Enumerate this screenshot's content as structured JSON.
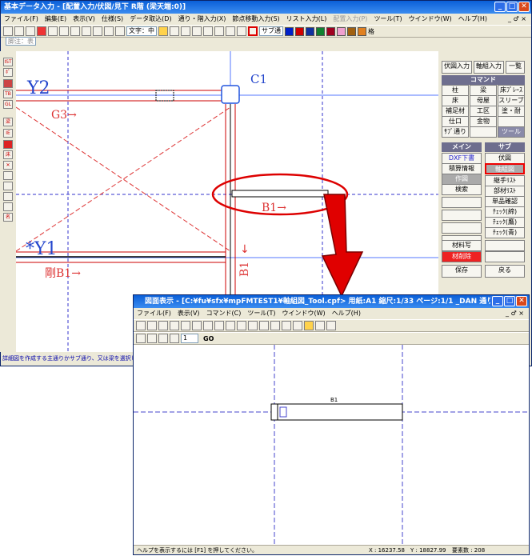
{
  "main": {
    "title": "基本データ入力 - [配置入力/伏図/見下 R階 (梁天端:0)]",
    "menu": [
      "ファイル(F)",
      "編集(E)",
      "表示(V)",
      "仕様(S)",
      "データ取込(D)",
      "通り・階入力(X)",
      "節点移動入力(S)",
      "リスト入力(L)",
      "配置入力(P)",
      "ツール(T)",
      "ウインドウ(W)",
      "ヘルプ(H)"
    ],
    "text_select": "文字：中",
    "sub_grid": "サブ通",
    "lattice": "格",
    "fold": "脚注：表",
    "status": "詳細図を作成する主通りかサブ通り、又は梁を選択してください"
  },
  "drawing": {
    "y2": "Y2",
    "y1": "*Y1",
    "c1": "C1",
    "g3": "G3→",
    "b1": "B1→",
    "b1v": "B1",
    "gb1": "剛B1→"
  },
  "left_tools": [
    "IST",
    "ﾎﾟ",
    "",
    "TB",
    "GL",
    "",
    "梁",
    "IE",
    "",
    "床",
    "",
    "",
    "",
    "",
    "",
    "",
    "名"
  ],
  "panel": {
    "tabs": [
      "伏図入力",
      "軸組入力",
      "一覧"
    ],
    "cmd_header": "コマンド",
    "cmd": [
      "柱",
      "梁",
      "床ﾌﾞﾚｰｽ",
      "床",
      "母屋",
      "スリーブ",
      "補足材",
      "工区",
      "塗・耐",
      "仕口",
      "金物",
      "",
      "ｻﾌﾞ通り",
      "",
      "ツール"
    ],
    "main_header": "メイン",
    "sub_header": "サブ",
    "main_btns": [
      "DXF下書",
      "積算情報",
      "作図",
      "検索",
      "",
      "",
      "",
      "",
      "材料写",
      "材削除"
    ],
    "sub_btns": [
      "伏図",
      "軸組図",
      "継手ﾘｽﾄ",
      "部材ﾘｽﾄ",
      "単品確認",
      "ﾁｪｯｸ(締)",
      "ﾁｪｯｸ(鷹)",
      "ﾁｪｯｸ(青)",
      "",
      ""
    ],
    "save": "保存",
    "back": "戻る"
  },
  "preview": {
    "title": "図面表示 - [C:¥fu¥sfx¥mpFMTEST1¥軸組図_Tool.cpf> 用紙:A1 縮尺:1/33 ページ:1/1 _DAN 通り 軸...",
    "menu": [
      "ファイル(F)",
      "表示(V)",
      "コマンド(C)",
      "ツール(T)",
      "ウインドウ(W)",
      "ヘルプ(H)"
    ],
    "page": "1",
    "go": "GO",
    "beam": "B1",
    "status": "ヘルプを表示するには [F1] を押してください。",
    "x": "X : 16237.58",
    "y": "Y : 18827.99",
    "count": "要素数 : 208"
  }
}
